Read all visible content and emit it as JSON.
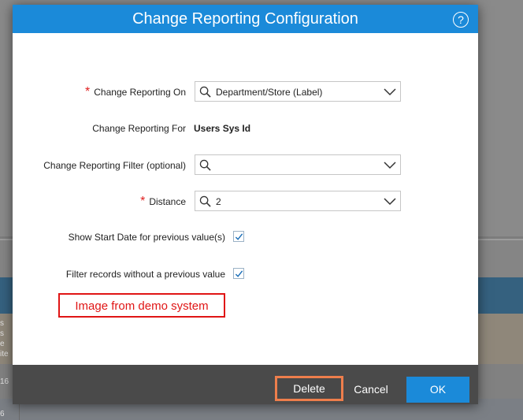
{
  "background": {
    "fragments": [
      "s",
      "s",
      "e",
      "ite",
      "16",
      "6"
    ]
  },
  "dialog": {
    "title": "Change Reporting Configuration",
    "help_symbol": "?",
    "fields": {
      "reporting_on": {
        "label": "Change Reporting On",
        "required": "*",
        "value": "Department/Store (Label)"
      },
      "reporting_for": {
        "label": "Change Reporting For",
        "value": "Users Sys Id"
      },
      "reporting_filter": {
        "label": "Change Reporting Filter (optional)",
        "value": ""
      },
      "distance": {
        "label": "Distance",
        "required": "*",
        "value": "2"
      }
    },
    "checkboxes": {
      "show_start_date": {
        "label": "Show Start Date for previous value(s)",
        "checked": true
      },
      "filter_records": {
        "label": "Filter records without a previous value",
        "checked": true
      }
    },
    "annotation": "Image from demo system",
    "buttons": {
      "delete": "Delete",
      "cancel": "Cancel",
      "ok": "OK"
    }
  },
  "icons": {
    "help": "help-circle-icon",
    "search": "search-icon",
    "dropdown": "chevron-down-icon",
    "check": "checkmark-icon"
  },
  "colors": {
    "header": "#1b8ad9",
    "required": "#e02020",
    "annotation": "#e01515",
    "delete_highlight": "#ee7e4c",
    "footer": "#4a4a4a"
  }
}
